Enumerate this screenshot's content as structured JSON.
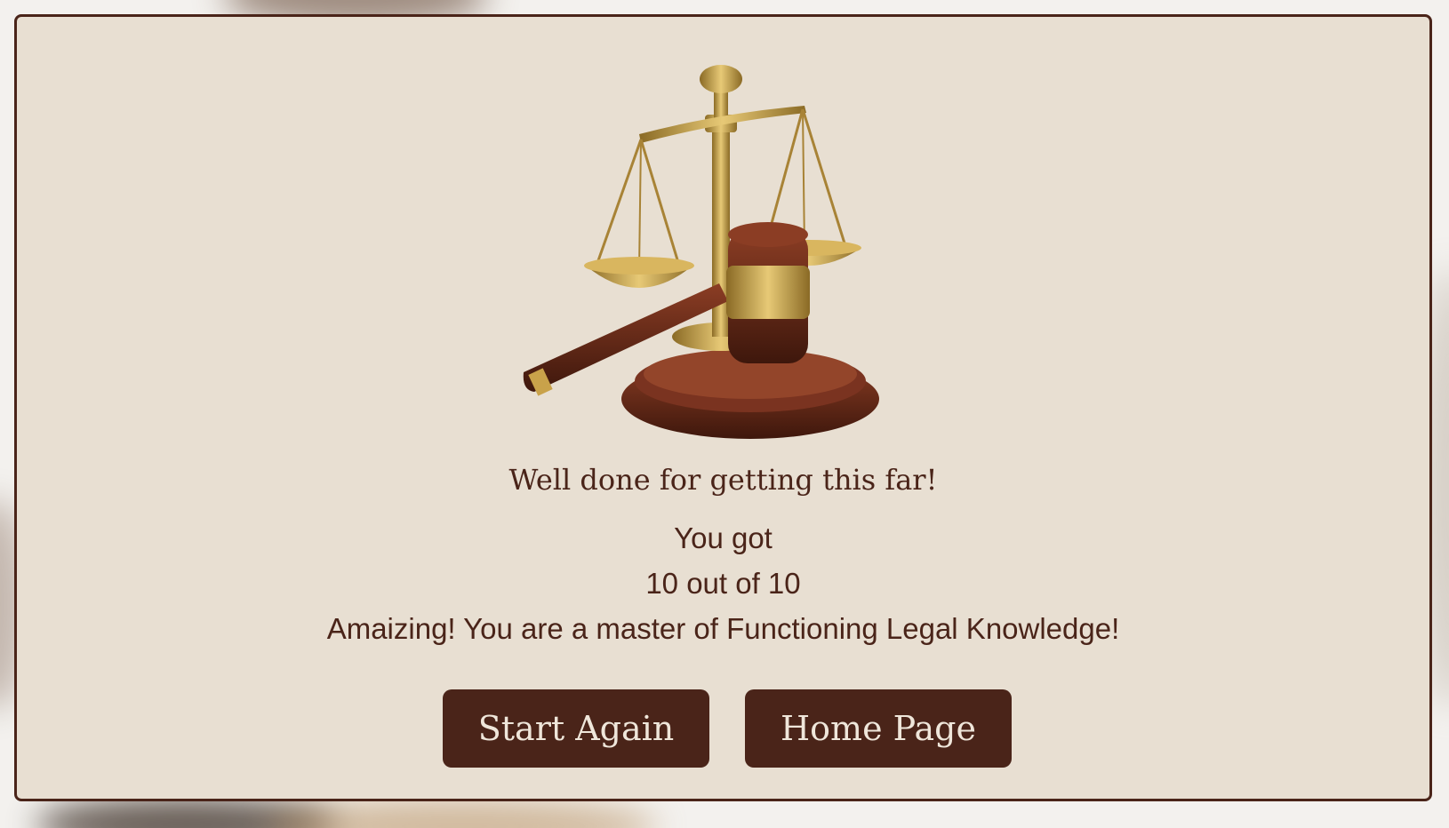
{
  "hero_image": {
    "subject": "scales-and-gavel-icon",
    "colors": {
      "brass": "#c9a24a",
      "brass_dark": "#8a6a25",
      "wood": "#6b2e1c",
      "wood_dark": "#3e170c"
    }
  },
  "result": {
    "headline": "Well done for getting this far!",
    "prefix": "You got",
    "score_text": "10 out of 10",
    "message": "Amaizing! You are a master of Functioning Legal Knowledge!"
  },
  "actions": {
    "start_again_label": "Start Again",
    "home_page_label": "Home Page"
  },
  "theme": {
    "panel_background": "#e8dfd2",
    "accent": "#4a2419",
    "button_text": "#efe6da"
  }
}
